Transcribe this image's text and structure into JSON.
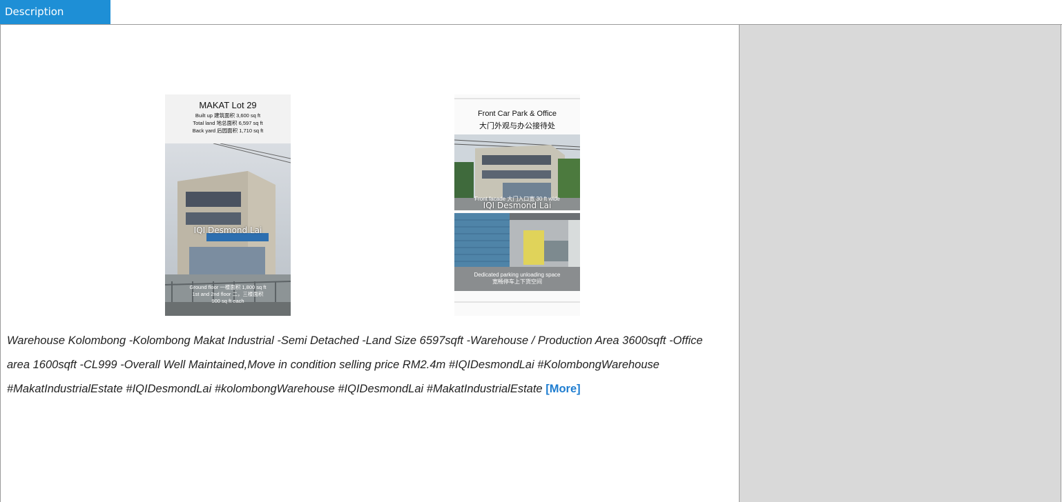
{
  "header": {
    "tab_label": "Description"
  },
  "images": [
    {
      "title": "MAKAT Lot 29",
      "lines": [
        "Built up 建筑面积 3,600 sq ft",
        "Total land 地总面积 6,597 sq ft",
        "Back yard 后园面积 1,710 sq ft"
      ],
      "watermark": "IQI Desmond Lai",
      "bottom_lines": [
        "Ground floor 一楼面积 1,800 sq ft",
        "1st and 2nd floor 二，三楼面积",
        "900 sq ft each"
      ]
    },
    {
      "title_en": "Front Car Park & Office",
      "title_zh": "大门外观与办公接待处",
      "caption1": "Front facade 大门入口宽 30 ft wide",
      "watermark": "IQI Desmond Lai",
      "caption2a": "Dedicated parking unloading space",
      "caption2b": "宽畅停车上下货空间"
    }
  ],
  "description": {
    "text": "Warehouse Kolombong  -Kolombong Makat Industrial  -Semi Detached  -Land Size 6597sqft  -Warehouse / Production Area 3600sqft  -Office area 1600sqft  -CL999  -Overall Well Maintained,Move in condition   selling price RM2.4m   #IQIDesmondLai  #KolombongWarehouse  #MakatIndustrialEstate   #IQIDesmondLai  #kolombongWarehouse   #IQIDesmondLai  #MakatIndustrialEstate ",
    "more_label": "[More]"
  }
}
